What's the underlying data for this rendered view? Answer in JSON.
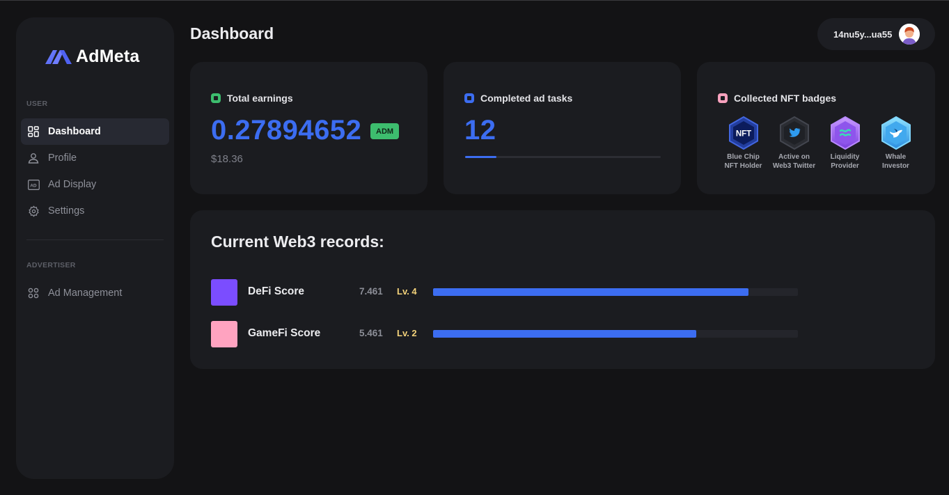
{
  "app": {
    "brand": "AdMeta",
    "page_title": "Dashboard",
    "wallet_address": "14nu5y...ua55"
  },
  "sidebar": {
    "sections": [
      {
        "label": "USER",
        "items": [
          {
            "label": "Dashboard",
            "icon": "dashboard-grid-icon",
            "active": true
          },
          {
            "label": "Profile",
            "icon": "user-icon",
            "active": false
          },
          {
            "label": "Ad Display",
            "icon": "ad-display-icon",
            "active": false
          },
          {
            "label": "Settings",
            "icon": "gear-icon",
            "active": false
          }
        ]
      },
      {
        "label": "ADVERTISER",
        "items": [
          {
            "label": "Ad Management",
            "icon": "command-icon",
            "active": false
          }
        ]
      }
    ]
  },
  "cards": {
    "earnings": {
      "title": "Total earnings",
      "value": "0.27894652",
      "token": "ADM",
      "usd": "$18.36",
      "accent": "#3dbd6e"
    },
    "tasks": {
      "title": "Completed ad tasks",
      "value": "12",
      "progress": 0.16,
      "accent": "#3c6df1"
    },
    "badges": {
      "title": "Collected NFT badges",
      "accent": "#f7a1bd",
      "items": [
        {
          "line1": "Blue Chip",
          "line2": "NFT Holder",
          "icon": "nft-badge-icon"
        },
        {
          "line1": "Active on",
          "line2": "Web3 Twitter",
          "icon": "twitter-badge-icon"
        },
        {
          "line1": "Liquidity",
          "line2": "Provider",
          "icon": "liquidity-badge-icon"
        },
        {
          "line1": "Whale",
          "line2": "Investor",
          "icon": "whale-badge-icon"
        }
      ]
    }
  },
  "records": {
    "title": "Current Web3 records:",
    "rows": [
      {
        "name": "DeFi Score",
        "score": "7.461",
        "level": "Lv. 4",
        "fill": 0.865,
        "color": "#7b4dff"
      },
      {
        "name": "GameFi Score",
        "score": "5.461",
        "level": "Lv. 2",
        "fill": 0.722,
        "color": "#ffa3c0"
      }
    ]
  },
  "colors": {
    "background": "#131315",
    "panel": "#1b1c20",
    "accent_blue": "#3c6df1",
    "level_gold": "#f3d27a"
  }
}
